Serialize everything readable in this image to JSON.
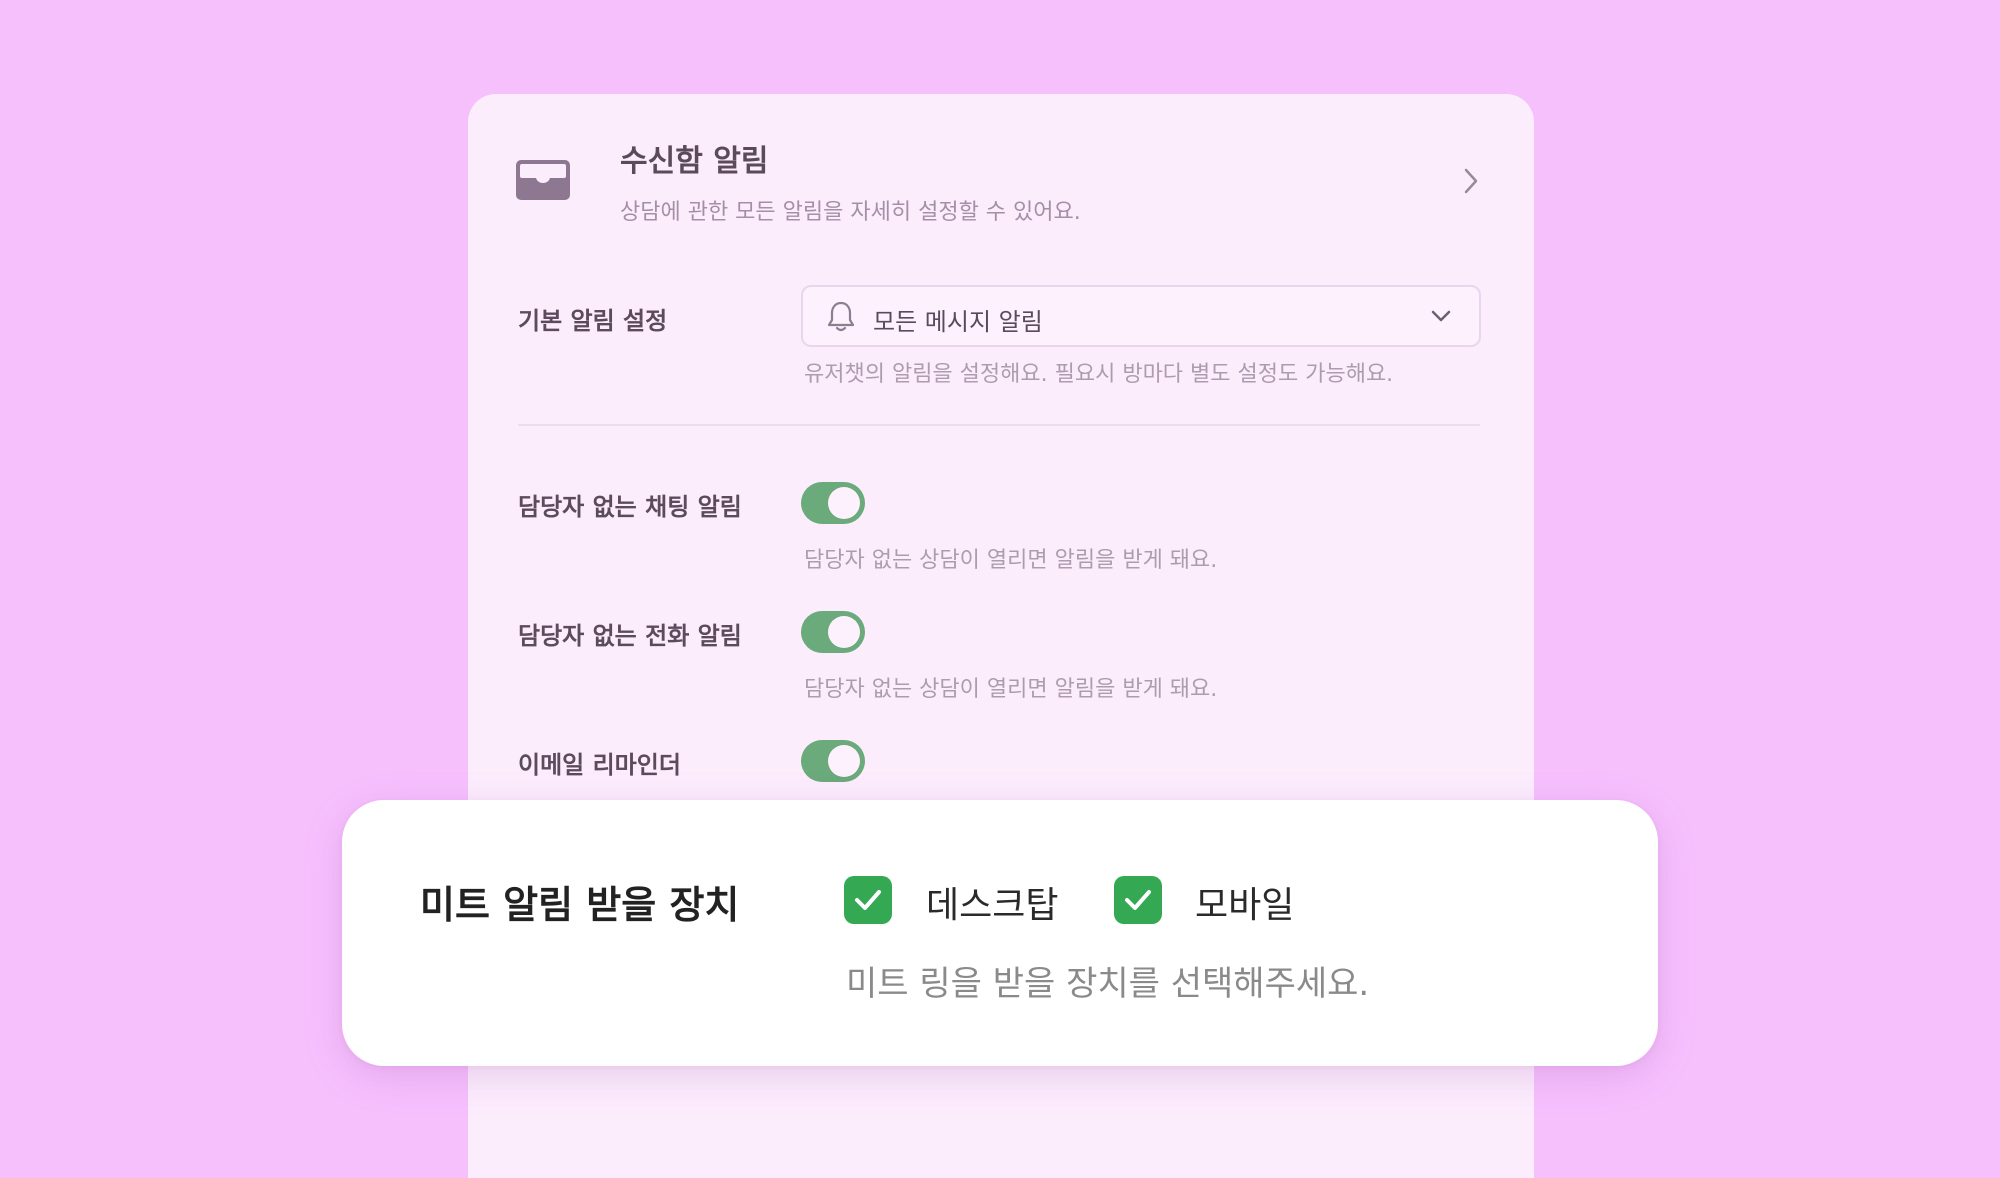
{
  "inbox": {
    "title": "수신함 알림",
    "subtitle": "상담에 관한 모든 알림을 자세히 설정할 수 있어요."
  },
  "default_notification": {
    "label": "기본 알림 설정",
    "selected_value": "모든 메시지 알림",
    "hint": "유저챗의 알림을 설정해요. 필요시 방마다 별도 설정도 가능해요."
  },
  "toggles": [
    {
      "label": "담당자 없는 채팅 알림",
      "hint": "담당자 없는 상담이 열리면 알림을 받게 돼요.",
      "on": true
    },
    {
      "label": "담당자 없는 전화 알림",
      "hint": "담당자 없는 상담이 열리면 알림을 받게 돼요.",
      "on": true
    },
    {
      "label": "이메일 리마인더",
      "hint": "",
      "on": true
    }
  ],
  "meet_devices": {
    "title": "미트 알림 받을 장치",
    "options": [
      {
        "label": "데스크탑",
        "checked": true
      },
      {
        "label": "모바일",
        "checked": true
      }
    ],
    "hint": "미트 링을 받을 장치를 선택해주세요."
  },
  "colors": {
    "background": "#f6c0fd",
    "panel": "#fcedfd",
    "toggle_on": "#6aaa7b",
    "checkbox": "#34a853"
  },
  "icons": {
    "inbox": "inbox-icon",
    "bell": "bell-icon",
    "chevron_right": "chevron-right-icon",
    "chevron_down": "chevron-down-icon",
    "check": "check-icon"
  }
}
